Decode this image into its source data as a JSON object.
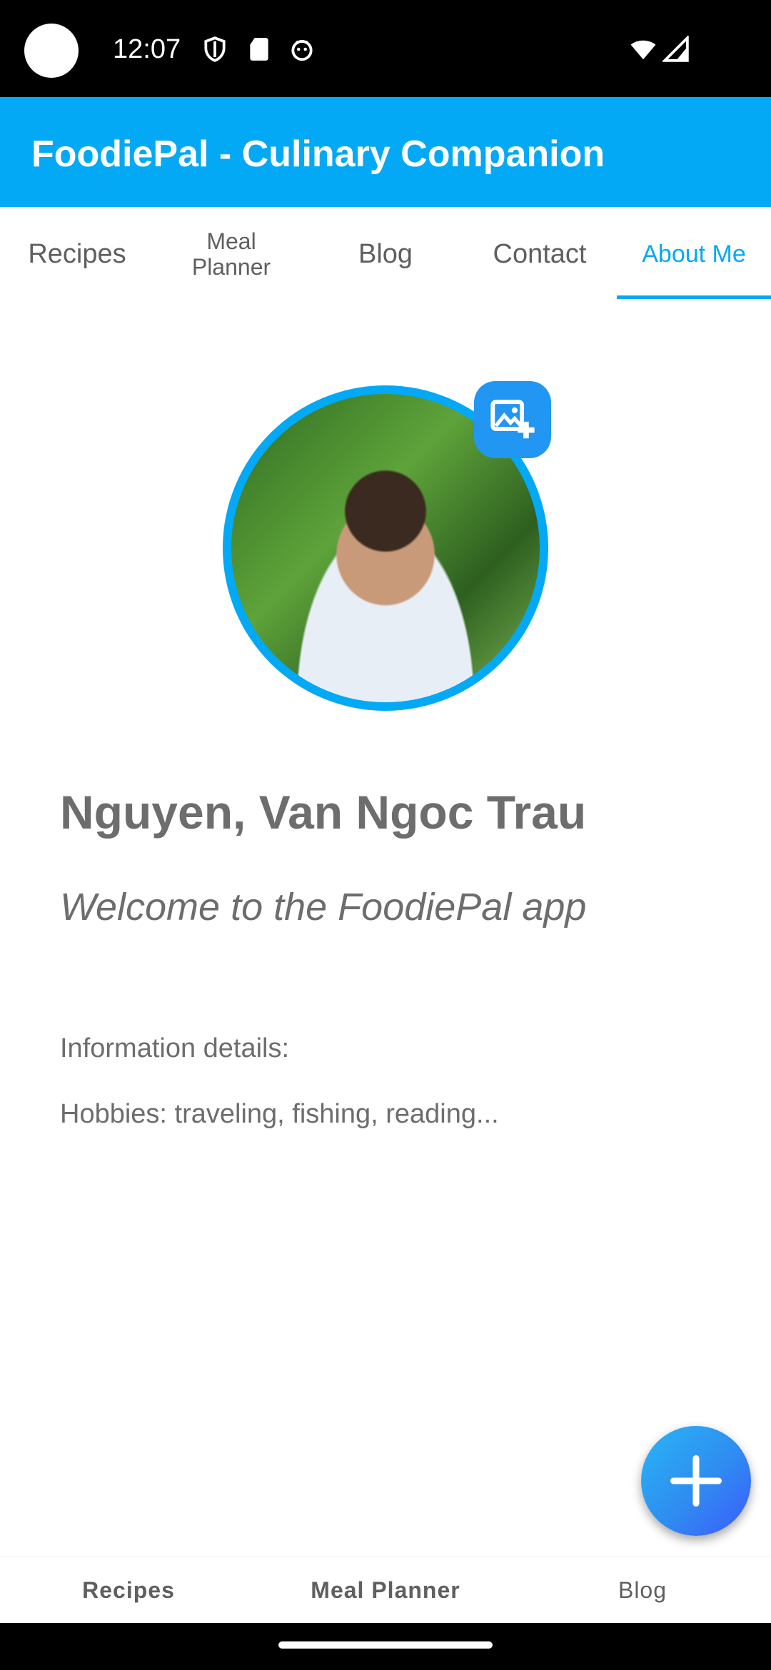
{
  "status_bar": {
    "time": "12:07",
    "icons": [
      "shield-icon",
      "sd-card-icon",
      "android-debug-icon",
      "wifi-icon",
      "signal-icon"
    ]
  },
  "app_bar": {
    "title": "FoodiePal - Culinary Companion"
  },
  "tabs": [
    {
      "label": "Recipes"
    },
    {
      "label": "Meal Planner"
    },
    {
      "label": "Blog"
    },
    {
      "label": "Contact"
    },
    {
      "label": "About Me",
      "active": true
    }
  ],
  "profile": {
    "name": "Nguyen, Van Ngoc Trau",
    "welcome": "Welcome to the FoodiePal app",
    "info_label": "Information details:",
    "hobbies": "Hobbies: traveling, fishing, reading..."
  },
  "bottom_nav": [
    {
      "label": "Recipes"
    },
    {
      "label": "Meal Planner"
    },
    {
      "label": "Blog"
    }
  ],
  "colors": {
    "primary": "#03a9f4",
    "text": "#6d6d6d",
    "fab_gradient_start": "#29b6f6",
    "fab_gradient_end": "#3d5afe"
  },
  "icons": {
    "add_photo": "add-photo-icon",
    "fab": "plus-icon"
  }
}
